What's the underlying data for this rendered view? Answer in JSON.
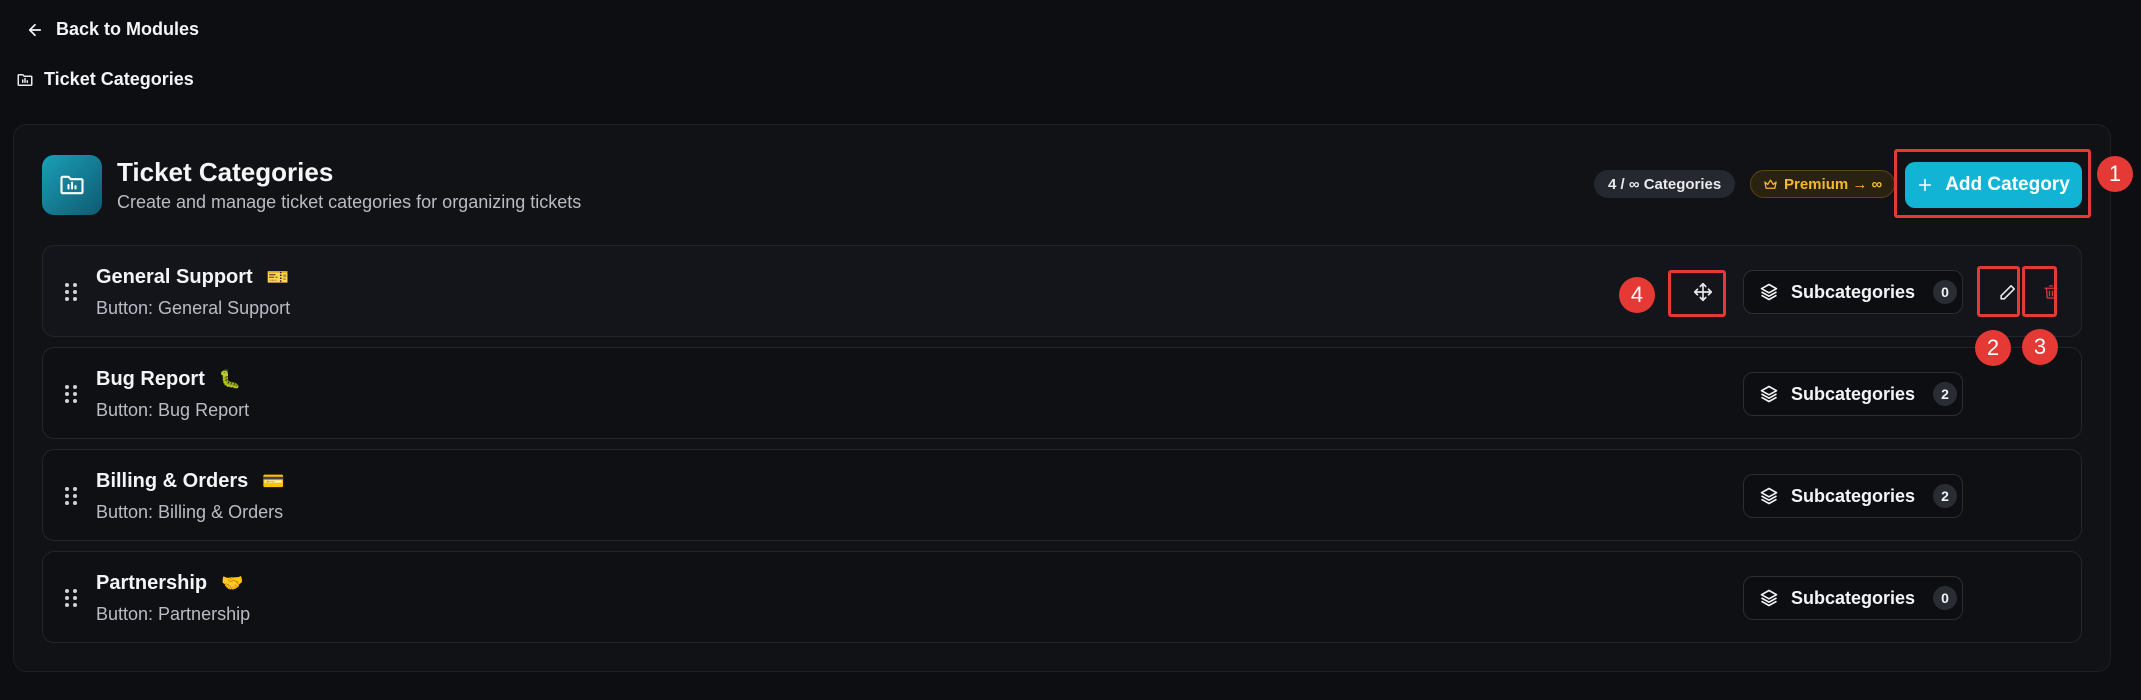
{
  "nav": {
    "back_label": "Back to Modules",
    "page_label": "Ticket Categories"
  },
  "header": {
    "title": "Ticket Categories",
    "subtitle": "Create and manage ticket categories for organizing tickets",
    "count_badge": "4 / ∞ Categories",
    "premium_badge": "Premium → ∞",
    "add_button": "Add Category"
  },
  "categories": [
    {
      "name": "General Support",
      "emoji": "🎫",
      "button_text": "Button: General Support",
      "subcategories_label": "Subcategories",
      "subcategory_count": "0"
    },
    {
      "name": "Bug Report",
      "emoji": "🐛",
      "button_text": "Button: Bug Report",
      "subcategories_label": "Subcategories",
      "subcategory_count": "2"
    },
    {
      "name": "Billing & Orders",
      "emoji": "💳",
      "button_text": "Button: Billing & Orders",
      "subcategories_label": "Subcategories",
      "subcategory_count": "2"
    },
    {
      "name": "Partnership",
      "emoji": "🤝",
      "button_text": "Button: Partnership",
      "subcategories_label": "Subcategories",
      "subcategory_count": "0"
    }
  ],
  "annotations": [
    "1",
    "2",
    "3",
    "4"
  ],
  "colors": {
    "accent": "#12b4d6",
    "annotation": "#e53935",
    "premium": "#f5b82e",
    "delete": "#d33a3a"
  }
}
